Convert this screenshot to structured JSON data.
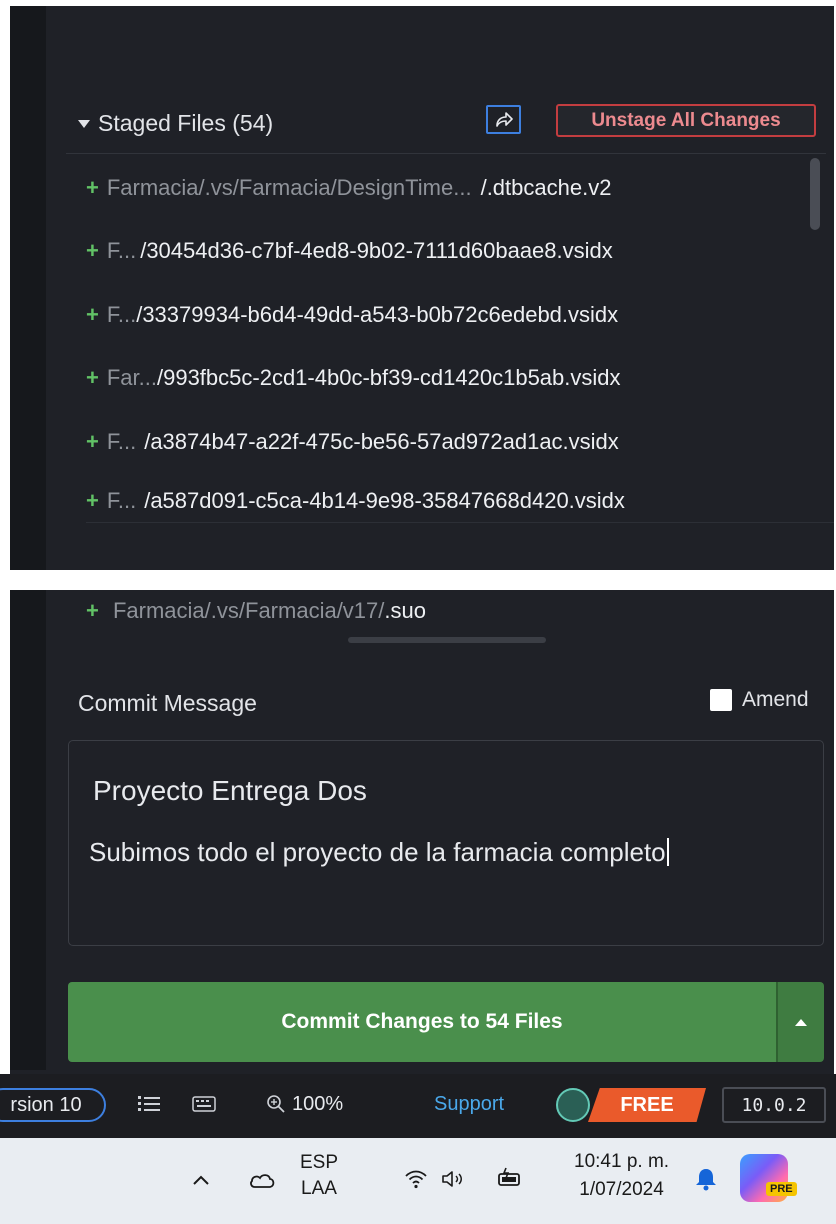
{
  "staged": {
    "title": "Staged Files (54)",
    "unstage_label": "Unstage All Changes",
    "files": [
      {
        "dim": "Farmacia/.vs/Farmacia/DesignTime...",
        "bright": "/.dtbcache.v2"
      },
      {
        "dim": "F... ",
        "bright": "/30454d36-c7bf-4ed8-9b02-7111d60baae8.vsidx"
      },
      {
        "dim": "F...",
        "bright": "/33379934-b6d4-49dd-a543-b0b72c6edebd.vsidx"
      },
      {
        "dim": "Far...",
        "bright": "/993fbc5c-2cd1-4b0c-bf39-cd1420c1b5ab.vsidx"
      },
      {
        "dim": "F... ",
        "bright": "/a3874b47-a22f-475c-be56-57ad972ad1ac.vsidx"
      },
      {
        "dim": "F... ",
        "bright": "/a587d091-c5ca-4b14-9e98-35847668d420.vsidx"
      }
    ],
    "last_file": {
      "dim": "Farmacia/.vs/Farmacia/v17/",
      "bright": ".suo"
    }
  },
  "commit": {
    "label": "Commit Message",
    "amend_label": "Amend",
    "summary": "Proyecto Entrega Dos",
    "description": "Subimos todo el proyecto de la farmacia completo",
    "button_label": "Commit Changes to 54 Files"
  },
  "status_bar": {
    "version_label": "rsion 10",
    "zoom": "100%",
    "support": "Support",
    "plan": "FREE",
    "app_version": "10.0.2"
  },
  "taskbar": {
    "lang_top": "ESP",
    "lang_bottom": "LAA",
    "time": "10:41 p. m.",
    "date": "1/07/2024",
    "pre_badge": "PRE"
  },
  "colors": {
    "panel_bg": "#1f2127",
    "add_green": "#61c266",
    "commit_green": "#4a8f4c",
    "unstage_red": "#c33d40",
    "accent_blue": "#3d7fdf",
    "free_orange": "#ea5a2b"
  },
  "icons": [
    "collapse-caret-icon",
    "share-icon",
    "list-icon",
    "keyboard-icon",
    "zoom-icon",
    "gitkraken-icon",
    "chevron-up-icon",
    "cloud-icon",
    "wifi-icon",
    "speaker-icon",
    "battery-icon",
    "bell-icon",
    "copilot-icon"
  ]
}
